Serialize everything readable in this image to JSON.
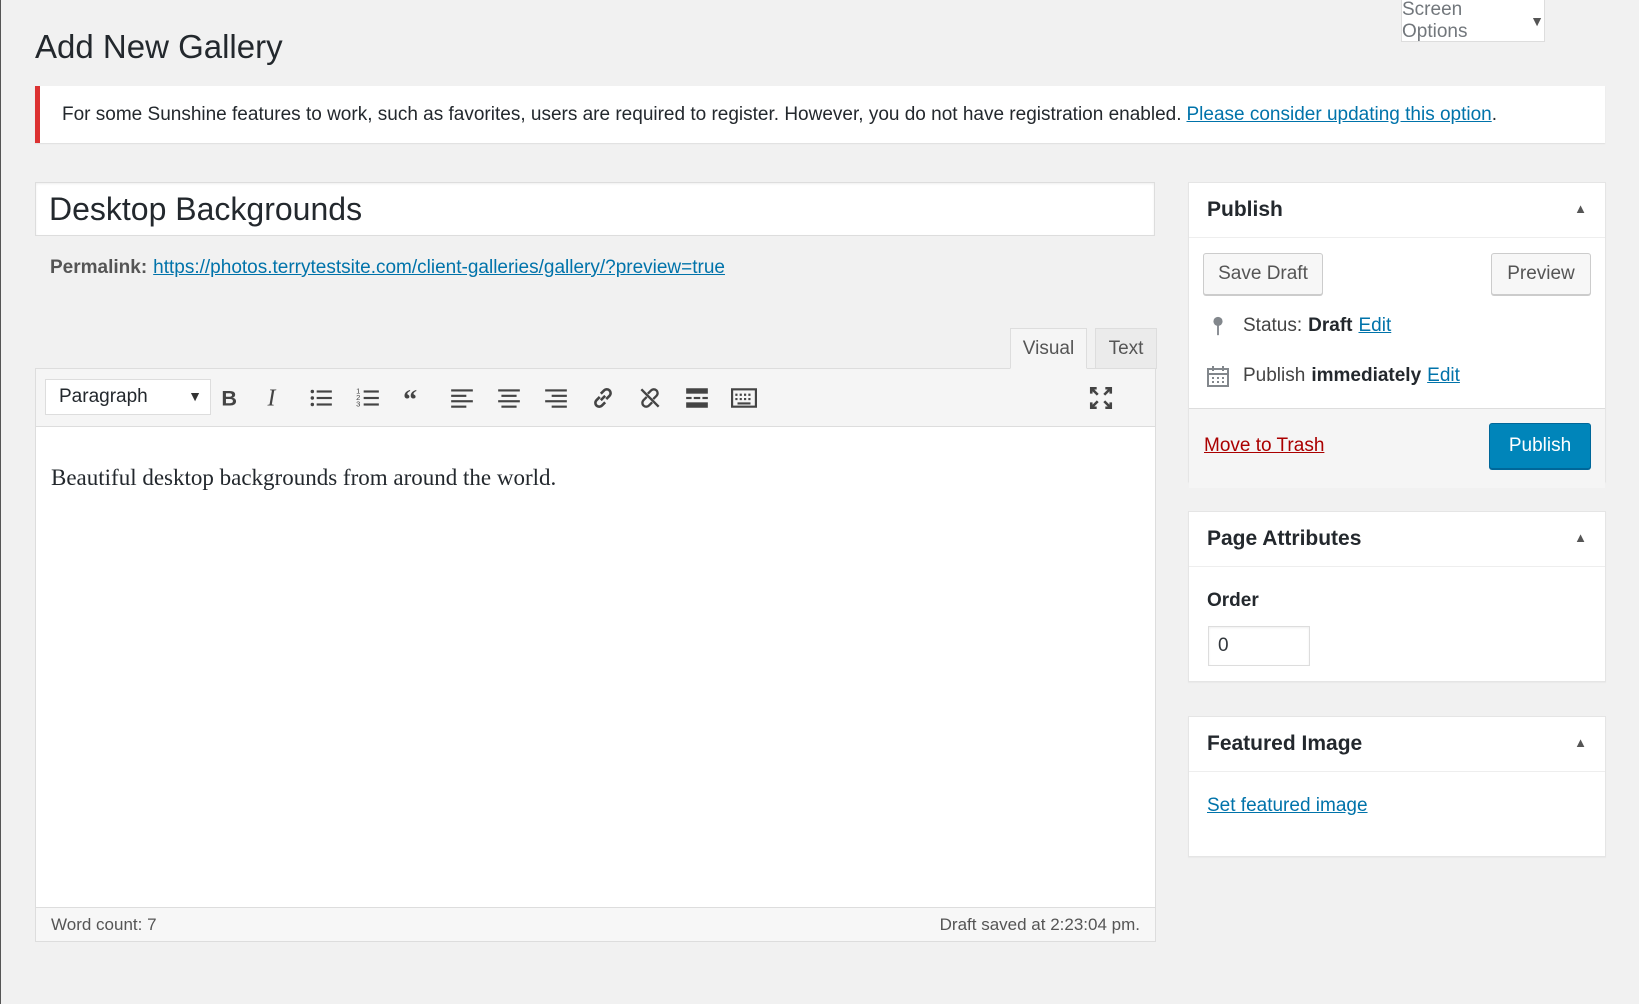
{
  "screen_options": {
    "label": "Screen Options",
    "arrow": "▼"
  },
  "page_title": "Add New Gallery",
  "notice": {
    "text": "For some Sunshine features to work, such as favorites, users are required to register. However, you do not have registration enabled.",
    "link": "Please consider updating this option",
    "trail": ".",
    "border_color": "#dc3232"
  },
  "post_title": "Desktop Backgrounds",
  "permalink": {
    "label": "Permalink:",
    "url": "https://photos.terrytestsite.com/client-galleries/gallery/?preview=true"
  },
  "editor": {
    "tabs": {
      "visual": "Visual",
      "text": "Text"
    },
    "format_select": "Paragraph",
    "toolbar_icons": [
      "bold-icon",
      "italic-icon",
      "bulleted-list-icon",
      "numbered-list-icon",
      "blockquote-icon",
      "align-left-icon",
      "align-center-icon",
      "align-right-icon",
      "link-icon",
      "unlink-icon",
      "read-more-icon",
      "toolbar-toggle-icon",
      "fullscreen-icon"
    ],
    "content": "Beautiful desktop backgrounds from around the world.",
    "word_count": "Word count: 7",
    "draft_saved": "Draft saved at 2:23:04 pm."
  },
  "publish_box": {
    "title": "Publish",
    "save_draft": "Save Draft",
    "preview": "Preview",
    "status_label": "Status:",
    "status_value": "Draft",
    "status_edit": "Edit",
    "publish_label": "Publish",
    "publish_value": "immediately",
    "publish_edit": "Edit",
    "trash": "Move to Trash",
    "publish_button": "Publish",
    "primary_color": "#0085ba"
  },
  "page_attributes": {
    "title": "Page Attributes",
    "order_label": "Order",
    "order_value": "0"
  },
  "featured_image": {
    "title": "Featured Image",
    "link": "Set featured image"
  },
  "toggle_arrow": "▲"
}
